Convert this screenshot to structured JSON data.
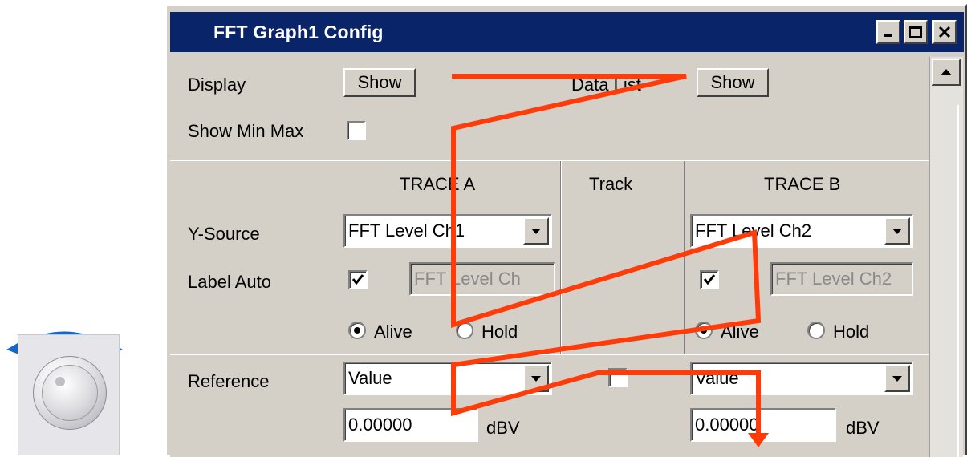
{
  "window": {
    "title": "FFT Graph1 Config",
    "title_bar_color": "#0a246a",
    "controls": [
      "minimize-icon",
      "maximize-icon",
      "close-icon"
    ]
  },
  "top_section": {
    "display_label": "Display",
    "display_button": "Show",
    "data_list_label": "Data List",
    "data_list_button": "Show",
    "show_min_max_label": "Show Min Max",
    "show_min_max_checked": false
  },
  "columns": {
    "trace_a": "TRACE A",
    "track": "Track",
    "trace_b": "TRACE B"
  },
  "rows": {
    "y_source_label": "Y-Source",
    "label_auto_label": "Label Auto",
    "reference_label": "Reference"
  },
  "trace_a": {
    "y_source": "FFT Level Ch1",
    "label_auto_checked": true,
    "label_text": "FFT Level Ch",
    "alive_label": "Alive",
    "hold_label": "Hold",
    "selected_mode": "Alive",
    "reference": "Value",
    "ref_value": "0.00000",
    "unit": "dBV"
  },
  "track": {
    "reference_checked": false
  },
  "trace_b": {
    "y_source": "FFT Level Ch2",
    "label_auto_checked": true,
    "label_text": "FFT Level Ch2",
    "alive_label": "Alive",
    "hold_label": "Hold",
    "selected_mode": "Alive",
    "reference": "Value",
    "ref_value": "0.00000",
    "unit": "dBV"
  },
  "annotation": {
    "path_color": "#ff3b0a"
  },
  "knob": {
    "arrow_color": "#1466c8"
  }
}
